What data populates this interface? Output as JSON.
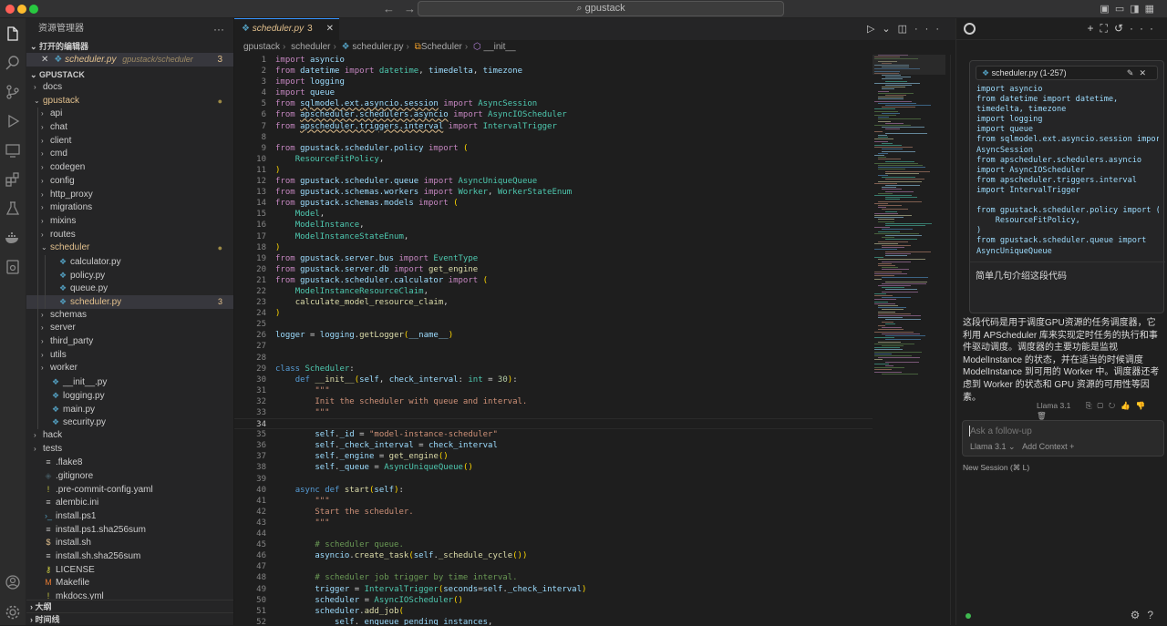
{
  "window": {
    "search": "gpustack"
  },
  "explorer": {
    "title": "资源管理器",
    "open_editors_label": "打开的编辑器",
    "open_file": {
      "name": "scheduler.py",
      "path": "gpustack/scheduler",
      "problems": "3"
    },
    "root_label": "GPUSTACK",
    "tree": [
      {
        "label": "docs",
        "depth": 1,
        "chev": "›",
        "icon": ""
      },
      {
        "label": "gpustack",
        "depth": 1,
        "chev": "⌄",
        "icon": "",
        "dot": true
      },
      {
        "label": "api",
        "depth": 2,
        "chev": "›",
        "icon": ""
      },
      {
        "label": "chat",
        "depth": 2,
        "chev": "›",
        "icon": ""
      },
      {
        "label": "client",
        "depth": 2,
        "chev": "›",
        "icon": ""
      },
      {
        "label": "cmd",
        "depth": 2,
        "chev": "›",
        "icon": ""
      },
      {
        "label": "codegen",
        "depth": 2,
        "chev": "›",
        "icon": ""
      },
      {
        "label": "config",
        "depth": 2,
        "chev": "›",
        "icon": ""
      },
      {
        "label": "http_proxy",
        "depth": 2,
        "chev": "›",
        "icon": ""
      },
      {
        "label": "migrations",
        "depth": 2,
        "chev": "›",
        "icon": ""
      },
      {
        "label": "mixins",
        "depth": 2,
        "chev": "›",
        "icon": ""
      },
      {
        "label": "routes",
        "depth": 2,
        "chev": "›",
        "icon": ""
      },
      {
        "label": "scheduler",
        "depth": 2,
        "chev": "⌄",
        "icon": "",
        "dot": true
      },
      {
        "label": "calculator.py",
        "depth": 3,
        "chev": "",
        "icon": "py"
      },
      {
        "label": "policy.py",
        "depth": 3,
        "chev": "",
        "icon": "py"
      },
      {
        "label": "queue.py",
        "depth": 3,
        "chev": "",
        "icon": "py"
      },
      {
        "label": "scheduler.py",
        "depth": 3,
        "chev": "",
        "icon": "py",
        "active": true,
        "badge": "3"
      },
      {
        "label": "schemas",
        "depth": 2,
        "chev": "›",
        "icon": ""
      },
      {
        "label": "server",
        "depth": 2,
        "chev": "›",
        "icon": ""
      },
      {
        "label": "third_party",
        "depth": 2,
        "chev": "›",
        "icon": ""
      },
      {
        "label": "utils",
        "depth": 2,
        "chev": "›",
        "icon": ""
      },
      {
        "label": "worker",
        "depth": 2,
        "chev": "›",
        "icon": ""
      },
      {
        "label": "__init__.py",
        "depth": 2,
        "chev": "",
        "icon": "py"
      },
      {
        "label": "logging.py",
        "depth": 2,
        "chev": "",
        "icon": "py"
      },
      {
        "label": "main.py",
        "depth": 2,
        "chev": "",
        "icon": "py"
      },
      {
        "label": "security.py",
        "depth": 2,
        "chev": "",
        "icon": "py"
      },
      {
        "label": "hack",
        "depth": 1,
        "chev": "›",
        "icon": ""
      },
      {
        "label": "tests",
        "depth": 1,
        "chev": "›",
        "icon": ""
      },
      {
        "label": ".flake8",
        "depth": 1,
        "chev": "",
        "icon": "cfg"
      },
      {
        "label": ".gitignore",
        "depth": 1,
        "chev": "",
        "icon": "git"
      },
      {
        "label": ".pre-commit-config.yaml",
        "depth": 1,
        "chev": "",
        "icon": "yml"
      },
      {
        "label": "alembic.ini",
        "depth": 1,
        "chev": "",
        "icon": "cfg"
      },
      {
        "label": "install.ps1",
        "depth": 1,
        "chev": "",
        "icon": "ps"
      },
      {
        "label": "install.ps1.sha256sum",
        "depth": 1,
        "chev": "",
        "icon": "cfg"
      },
      {
        "label": "install.sh",
        "depth": 1,
        "chev": "",
        "icon": "sh"
      },
      {
        "label": "install.sh.sha256sum",
        "depth": 1,
        "chev": "",
        "icon": "cfg"
      },
      {
        "label": "LICENSE",
        "depth": 1,
        "chev": "",
        "icon": "lic"
      },
      {
        "label": "Makefile",
        "depth": 1,
        "chev": "",
        "icon": "mk"
      },
      {
        "label": "mkdocs.yml",
        "depth": 1,
        "chev": "",
        "icon": "yml"
      }
    ],
    "outline_label": "大纲",
    "timeline_label": "时间线"
  },
  "editor": {
    "tab": {
      "name": "scheduler.py",
      "problems": "3"
    },
    "breadcrumb": [
      "gpustack",
      "scheduler",
      "scheduler.py",
      "Scheduler",
      "__init__"
    ]
  },
  "chat": {
    "card_title": "scheduler.py (1-257)",
    "card_code": "import asyncio\nfrom datetime import datetime,\ntimedelta, timezone\nimport logging\nimport queue\nfrom sqlmodel.ext.asyncio.session import\nAsyncSession\nfrom apscheduler.schedulers.asyncio\nimport AsyncIOScheduler\nfrom apscheduler.triggers.interval\nimport IntervalTrigger\n\nfrom gpustack.scheduler.policy import (\n    ResourceFitPolicy,\n)\nfrom gpustack.scheduler.queue import\nAsyncUniqueQueue",
    "prompt": "简单几句介绍这段代码",
    "answer": "这段代码是用于调度GPU资源的任务调度器，它利用 APScheduler 库来实现定时任务的执行和事件驱动调度。调度器的主要功能是监视 ModelInstance 的状态，并在适当的时候调度 ModelInstance 到可用的 Worker 中。调度器还考虑到 Worker 的状态和 GPU 资源的可用性等因素。",
    "model": "Llama 3.1",
    "followup_placeholder": "Ask a follow-up",
    "followup_model": "Llama 3.1 ⌄",
    "add_context": "Add Context +",
    "new_session": "New Session (⌘ L)"
  }
}
